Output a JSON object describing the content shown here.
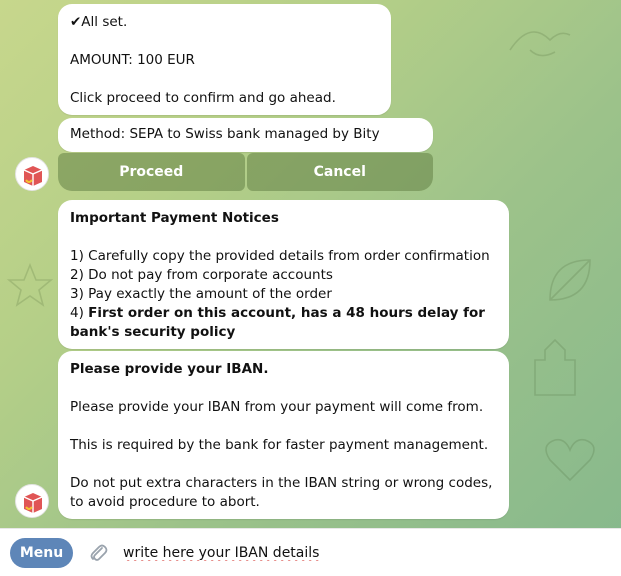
{
  "messages": {
    "confirm": {
      "all_set": "✔All set.",
      "amount": "AMOUNT: 100 EUR",
      "instruction": "Click proceed to confirm and go ahead."
    },
    "method": "Method: SEPA to Swiss bank managed by Bity",
    "buttons": {
      "proceed": "Proceed",
      "cancel": "Cancel"
    },
    "notices": {
      "title": "Important Payment Notices",
      "item1": "1) Carefully copy the provided details from order confirmation",
      "item2": "2) Do not pay from corporate accounts",
      "item3": "3) Pay exactly the amount of the order",
      "item4_prefix": "4) ",
      "item4_bold": "First order on this account, has a 48 hours delay for bank's security policy"
    },
    "iban": {
      "title": "Please provide your IBAN.",
      "line1": "Please provide your IBAN from your payment will come from.",
      "line2": "This is required by the bank for faster payment management.",
      "line3": "Do not put extra characters in the IBAN string or wrong codes, to avoid procedure to abort."
    }
  },
  "input_bar": {
    "menu_label": "Menu",
    "attach_icon": "paperclip-icon",
    "input_value": "write here your IBAN details"
  },
  "colors": {
    "menu_button": "#5e86b8",
    "inline_button": "#64824699",
    "bubble": "#ffffff",
    "background": "#b5cf88"
  }
}
